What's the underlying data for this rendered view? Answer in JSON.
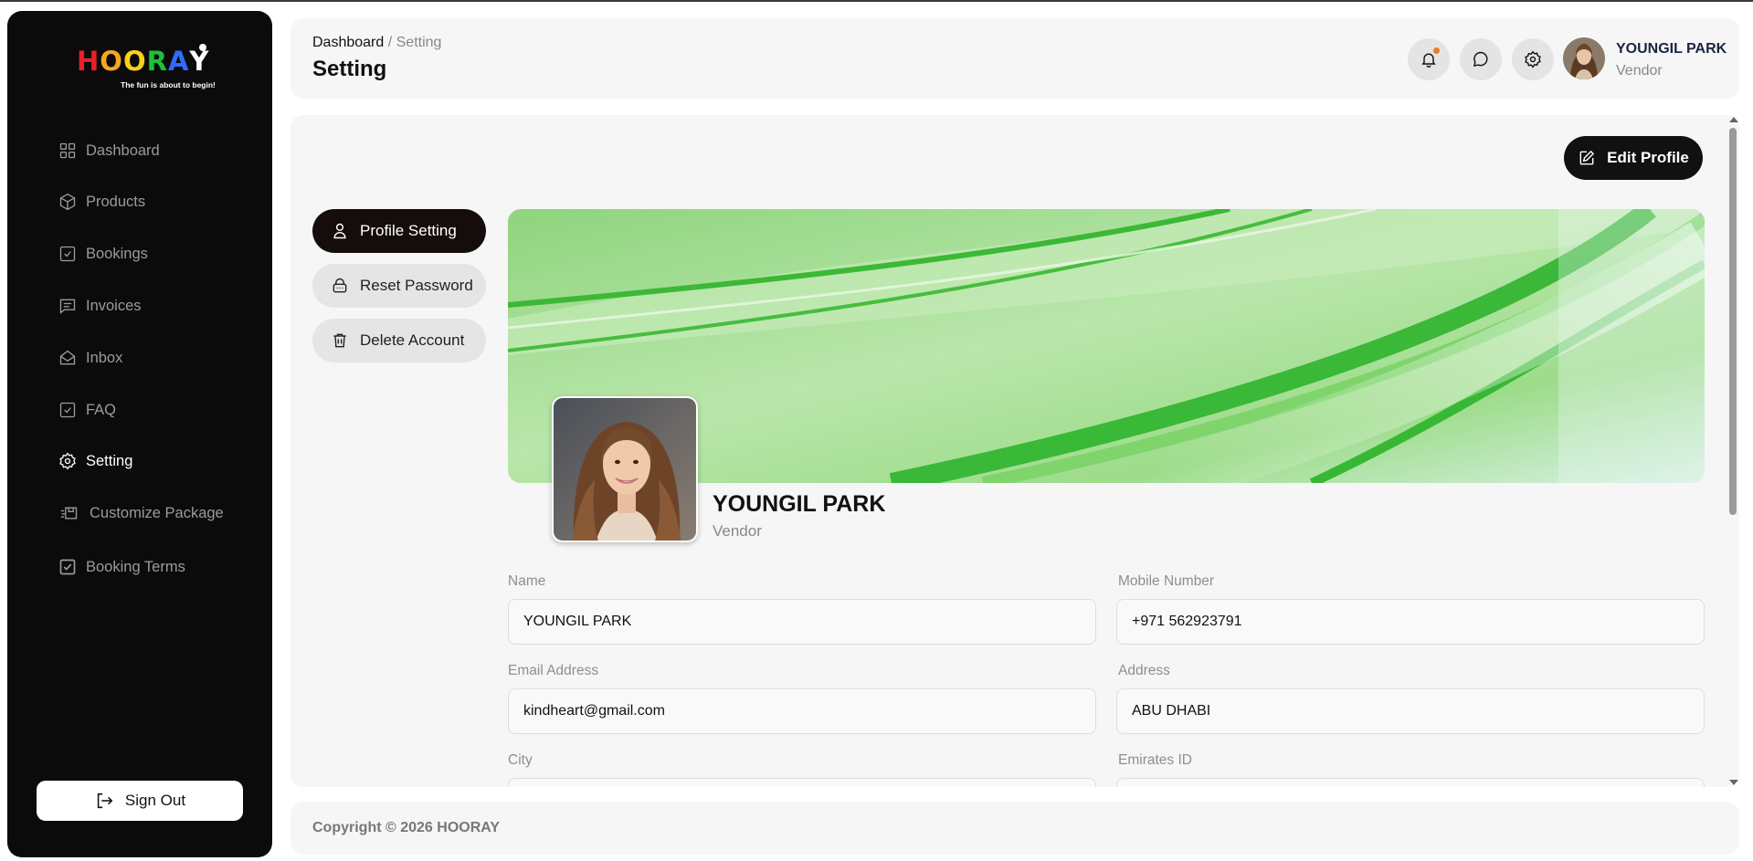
{
  "brand": {
    "logo_letters": [
      "H",
      "O",
      "O",
      "R",
      "A",
      "Y"
    ],
    "logo_colors": [
      "#e8202a",
      "#f5a623",
      "#f7d21a",
      "#1fbf3a",
      "#2f6bff",
      "#ffffff"
    ],
    "tagline": "The fun is about to begin!"
  },
  "sidebar": {
    "items": [
      {
        "label": "Dashboard",
        "icon": "grid-icon",
        "active": false
      },
      {
        "label": "Products",
        "icon": "box-icon",
        "active": false
      },
      {
        "label": "Bookings",
        "icon": "check-square-icon",
        "active": false
      },
      {
        "label": "Invoices",
        "icon": "message-square-icon",
        "active": false
      },
      {
        "label": "Inbox",
        "icon": "mail-open-icon",
        "active": false
      },
      {
        "label": "FAQ",
        "icon": "check-square-icon",
        "active": false
      },
      {
        "label": "Setting",
        "icon": "gear-icon",
        "active": true
      },
      {
        "label": "Customize Package",
        "icon": "package-icon",
        "active": false
      },
      {
        "label": "Booking Terms",
        "icon": "checkbox-icon",
        "active": false
      }
    ],
    "sign_out_label": "Sign Out"
  },
  "header": {
    "breadcrumb": {
      "parent": "Dashboard",
      "separator": " / ",
      "current": "Setting"
    },
    "title": "Setting",
    "user": {
      "name": "YOUNGIL PARK",
      "role": "Vendor"
    },
    "notification_dot_color": "#f07b28"
  },
  "profile": {
    "edit_button_label": "Edit Profile",
    "tabs": [
      {
        "label": "Profile Setting",
        "icon": "user-icon",
        "active": true
      },
      {
        "label": "Reset Password",
        "icon": "lock-icon",
        "active": false
      },
      {
        "label": "Delete Account",
        "icon": "trash-icon",
        "active": false
      }
    ],
    "name": "YOUNGIL PARK",
    "role": "Vendor",
    "fields": {
      "name": {
        "label": "Name",
        "value": "YOUNGIL PARK"
      },
      "mobile": {
        "label": "Mobile Number",
        "value": "+971 562923791"
      },
      "email": {
        "label": "Email Address",
        "value": "kindheart@gmail.com"
      },
      "address": {
        "label": "Address",
        "value": "ABU DHABI"
      },
      "city": {
        "label": "City",
        "value": ""
      },
      "emirates_id": {
        "label": "Emirates ID",
        "value": ""
      }
    }
  },
  "footer": {
    "copyright": "Copyright © 2026 HOORAY"
  }
}
